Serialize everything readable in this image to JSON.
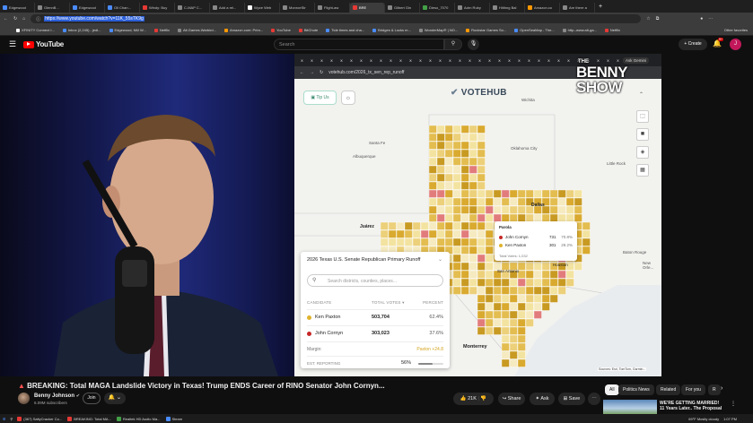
{
  "browser": {
    "tabs": [
      {
        "label": "Edgewood",
        "color": "#4a8cff"
      },
      {
        "label": "GlennB...",
        "color": "#888888"
      },
      {
        "label": "Edgewood",
        "color": "#4a8cff"
      },
      {
        "label": "Oil Chan...",
        "color": "#4a8cff"
      },
      {
        "label": "Windy: Buy",
        "color": "#e53935"
      },
      {
        "label": "C-MAP C...",
        "color": "#888888"
      },
      {
        "label": "Add a rel...",
        "color": "#888888"
      },
      {
        "label": "Wyze Web",
        "color": "#ffffff"
      },
      {
        "label": "MonroeStr",
        "color": "#888888"
      },
      {
        "label": "Flight-aw",
        "color": "#888888"
      },
      {
        "label": "BRE",
        "color": "#e53935"
      },
      {
        "label": "Gilbert Gin",
        "color": "#888888"
      },
      {
        "label": "Dieso_7070",
        "color": "#43a047"
      },
      {
        "label": "Adrn Ruby",
        "color": "#888888"
      },
      {
        "label": "Hilthng Bal",
        "color": "#888888"
      },
      {
        "label": "Amazon.co",
        "color": "#ff9800"
      },
      {
        "label": "Are there a",
        "color": "#888888"
      }
    ],
    "url": "https://www.youtube.com/watch?v=11K_55sTK9g",
    "bookmarks": [
      {
        "label": "XFINITY Connect I...",
        "color": "#ffffff"
      },
      {
        "label": "Inbox (2,245) - jedi...",
        "color": "#4a8cff"
      },
      {
        "label": "Edgewood, NM W...",
        "color": "#4a8cff"
      },
      {
        "label": "Netflix",
        "color": "#e53935"
      },
      {
        "label": "Alt.Games.Warbird...",
        "color": "#888888"
      },
      {
        "label": "Amazon.com: Prim...",
        "color": "#ff9800"
      },
      {
        "label": "YouTube",
        "color": "#e53935"
      },
      {
        "label": "BitChute",
        "color": "#e53935"
      },
      {
        "label": "Tide times and cha...",
        "color": "#4a8cff"
      },
      {
        "label": "Bridges & Locks m...",
        "color": "#4a8cff"
      },
      {
        "label": "WonderMap® | NO...",
        "color": "#888888"
      },
      {
        "label": "Rockstar Games So...",
        "color": "#ff9800"
      },
      {
        "label": "OpenSeaMap - The...",
        "color": "#4a8cff"
      },
      {
        "label": "http--www.alt-ga...",
        "color": "#888888"
      },
      {
        "label": "Netflix",
        "color": "#e53935"
      }
    ],
    "other_favorites": "Other favorites"
  },
  "youtube": {
    "logo_text": "YouTube",
    "search_placeholder": "Search",
    "create_label": "Create",
    "notif_count": "9+",
    "account_initial": "J"
  },
  "video": {
    "embedded_url": "votehub.com/2026_tx_sen_rep_runoff",
    "embedded_tabs": [
      "X",
      "X",
      "X",
      "X",
      "X",
      "X",
      "X",
      "X",
      "X",
      "X",
      "X",
      "X",
      "X",
      "X",
      "X",
      "X",
      "X",
      "X",
      "X",
      "X",
      "X",
      "X",
      "X",
      "X",
      "X",
      "X",
      "X",
      "X",
      "X",
      "X",
      "X",
      "X",
      "X"
    ],
    "ask_gemini": "Ask Gemini",
    "tip_us": "Tip Us",
    "votehub_logo": "VOTEHUB",
    "overlay_logo_line1": "THE",
    "overlay_logo_line2": "BENNY",
    "overlay_logo_line3": "SHOW",
    "map_labels": {
      "wichita": "Wichita",
      "santa_fe": "Santa Fe",
      "oklahoma_city": "Oklahoma City",
      "albuquerque": "Albuquerque",
      "little_rock": "Little Rock",
      "dallas": "Dallas",
      "juarez": "Juárez",
      "san_antonio": "San Antonio",
      "houston": "Houston",
      "baton_rouge": "Baton Rouge",
      "new_orleans": "New Orle...",
      "monterrey": "Monterrey",
      "sources": "Sources: Esri, TomTom, Garmin..."
    },
    "tooltip": {
      "county": "Parola",
      "rows": [
        {
          "name": "John Cornyn",
          "votes": "731",
          "pct": "70.8%",
          "color": "#c62828"
        },
        {
          "name": "Ken Paxton",
          "votes": "301",
          "pct": "29.2%",
          "color": "#e0b32c"
        }
      ],
      "total": "Total Votes: 1,032"
    },
    "card": {
      "title": "2026 Texas U.S. Senate Republican Primary Runoff",
      "search_placeholder": "Search districts, counties, places...",
      "col_candidate": "CANDIDATE",
      "col_total": "TOTAL VOTES",
      "col_percent": "PERCENT",
      "rows": [
        {
          "name": "Ken Paxton",
          "votes": "503,704",
          "pct": "62.4%",
          "color": "#e0b32c"
        },
        {
          "name": "John Cornyn",
          "votes": "303,023",
          "pct": "37.6%",
          "color": "#c62828"
        }
      ],
      "margin_label": "Margin:",
      "margin_value": "Paxton +24.8",
      "reporting_label": "EST. REPORTING",
      "reporting_value": "56%",
      "reporting_fraction": 0.56
    }
  },
  "title": {
    "text": "BREAKING: Total MAGA Landslide Victory in Texas! Trump ENDS Career of RINO Senator John Cornyn...",
    "channel_name": "Benny Johnson",
    "subscribers": "6.09M subscribers",
    "join_label": "Join",
    "likes": "21K",
    "share_label": "Share",
    "ask_label": "Ask",
    "save_label": "Save"
  },
  "chips": [
    "All",
    "Politics News",
    "Related",
    "For you",
    "R"
  ],
  "recommendation": {
    "title": "WE'RE GETTING MARRIED! 11 Years Later.. The Proposal"
  },
  "taskbar": {
    "items": [
      {
        "label": "(367) SaltyCracker Co...",
        "color": "#e53935"
      },
      {
        "label": "BREAKING: Total MA...",
        "color": "#e53935"
      },
      {
        "label": "Realtek HD Audio Ma...",
        "color": "#43a047"
      },
      {
        "label": "Steam",
        "color": "#4a8cff"
      }
    ],
    "weather": "69°F  Mostly cloudy",
    "time": "1:07 PM"
  },
  "colors": {
    "paxton": "#e0b32c",
    "cornyn": "#c62828",
    "youtube_red": "#ff0000"
  }
}
